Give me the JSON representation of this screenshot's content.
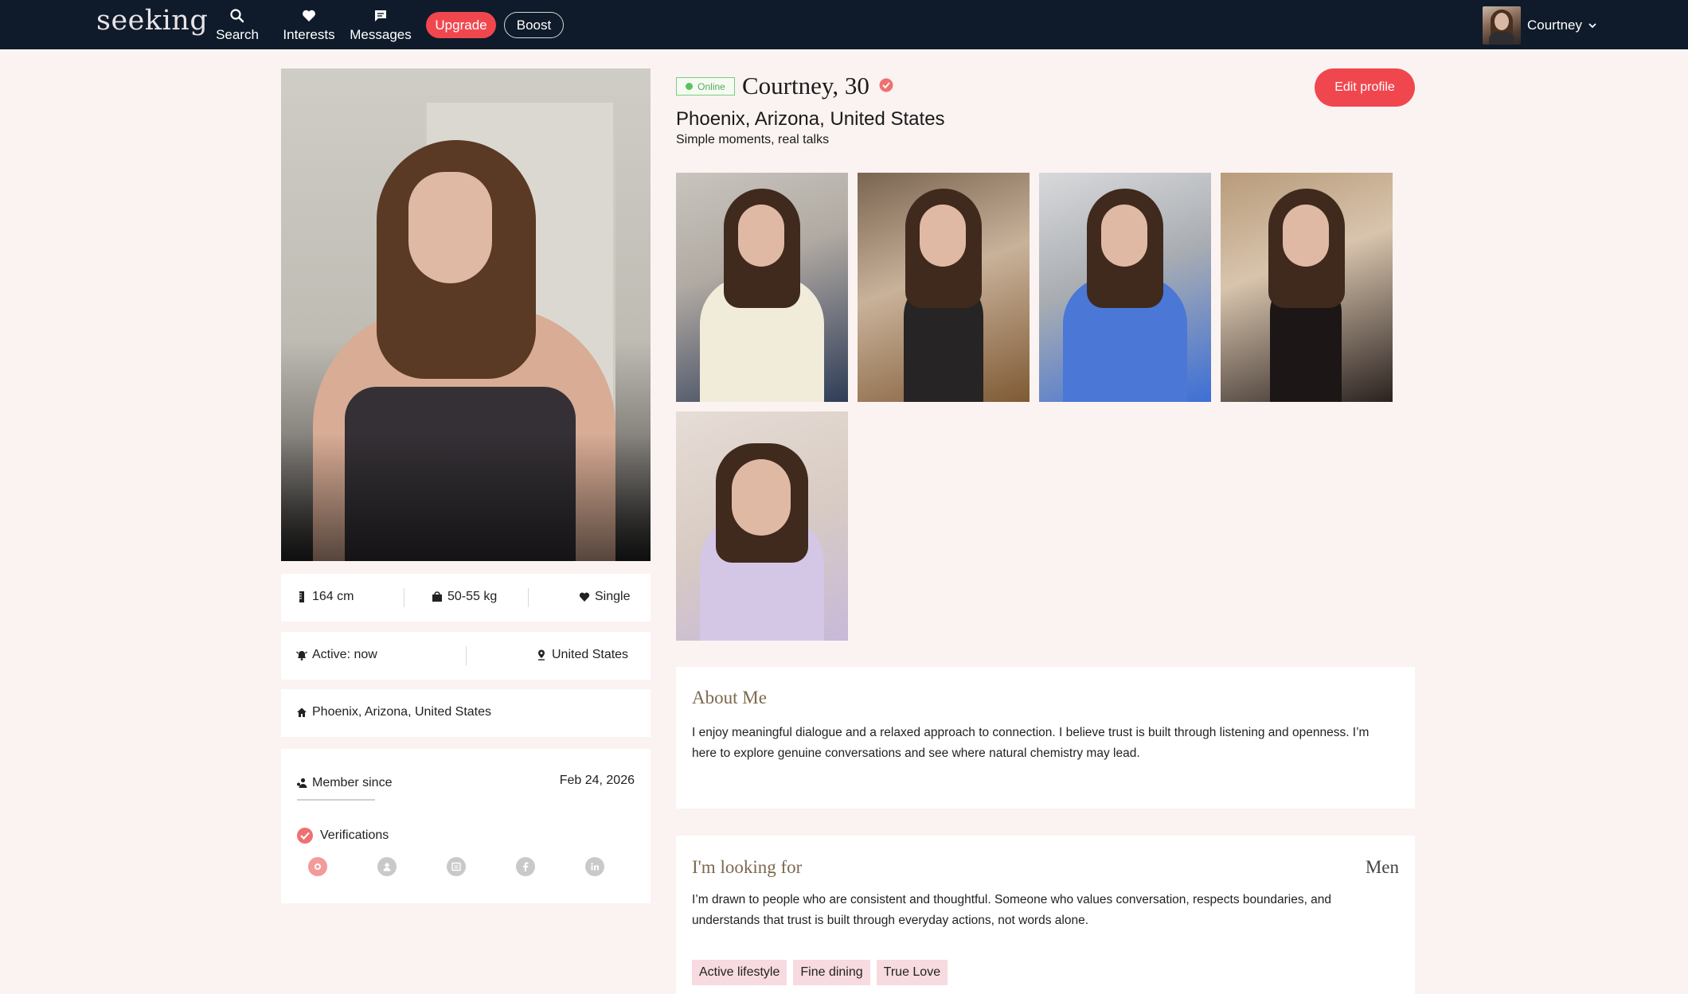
{
  "nav": {
    "logo": "seeking",
    "search_label": "Search",
    "interests_label": "Interests",
    "messages_label": "Messages",
    "upgrade_label": "Upgrade",
    "boost_label": "Boost",
    "user_name": "Courtney"
  },
  "profile": {
    "status": "Online",
    "name_age": "Courtney, 30",
    "location": "Phoenix, Arizona, United States",
    "tagline": "Simple moments, real talks",
    "edit_label": "Edit profile"
  },
  "stats": {
    "height": "164 cm",
    "weight": "50-55 kg",
    "relationship": "Single",
    "active": "Active: now",
    "country": "United States",
    "hometown": "Phoenix, Arizona, United States",
    "member_since_label": "Member since",
    "member_since_date": "Feb 24, 2026",
    "verifications_label": "Verifications"
  },
  "about": {
    "title": "About Me",
    "text": "I enjoy meaningful dialogue and a relaxed approach to connection. I believe trust is built through listening and openness. I’m here to explore genuine conversations and see where natural chemistry may lead."
  },
  "looking_for": {
    "title": "I'm looking for",
    "gender": "Men",
    "text": "I’m drawn to people who are consistent and thoughtful. Someone who values conversation, respects boundaries, and understands that trust is built through everyday actions, not words alone.",
    "tags": [
      "Active lifestyle",
      "Fine dining",
      "True Love"
    ]
  },
  "colors": {
    "nav_bg": "#0f1b2b",
    "accent": "#f0474f",
    "page_bg": "#fbf3f1",
    "online": "#5dc15d",
    "tag_bg": "#f7dbe0",
    "section_title": "#7d6850"
  },
  "icons": {
    "search": "search-icon",
    "interests": "heart-icon",
    "messages": "chat-icon",
    "height": "ruler-icon",
    "weight": "scale-icon",
    "relationship": "heart-icon",
    "active": "bell-icon",
    "country": "location-pin-icon",
    "hometown": "home-icon",
    "member": "people-icon",
    "verified": "check-circle-icon",
    "verifications": [
      "photo-verified-icon",
      "id-verified-icon",
      "document-icon",
      "facebook-icon",
      "linkedin-icon"
    ]
  }
}
